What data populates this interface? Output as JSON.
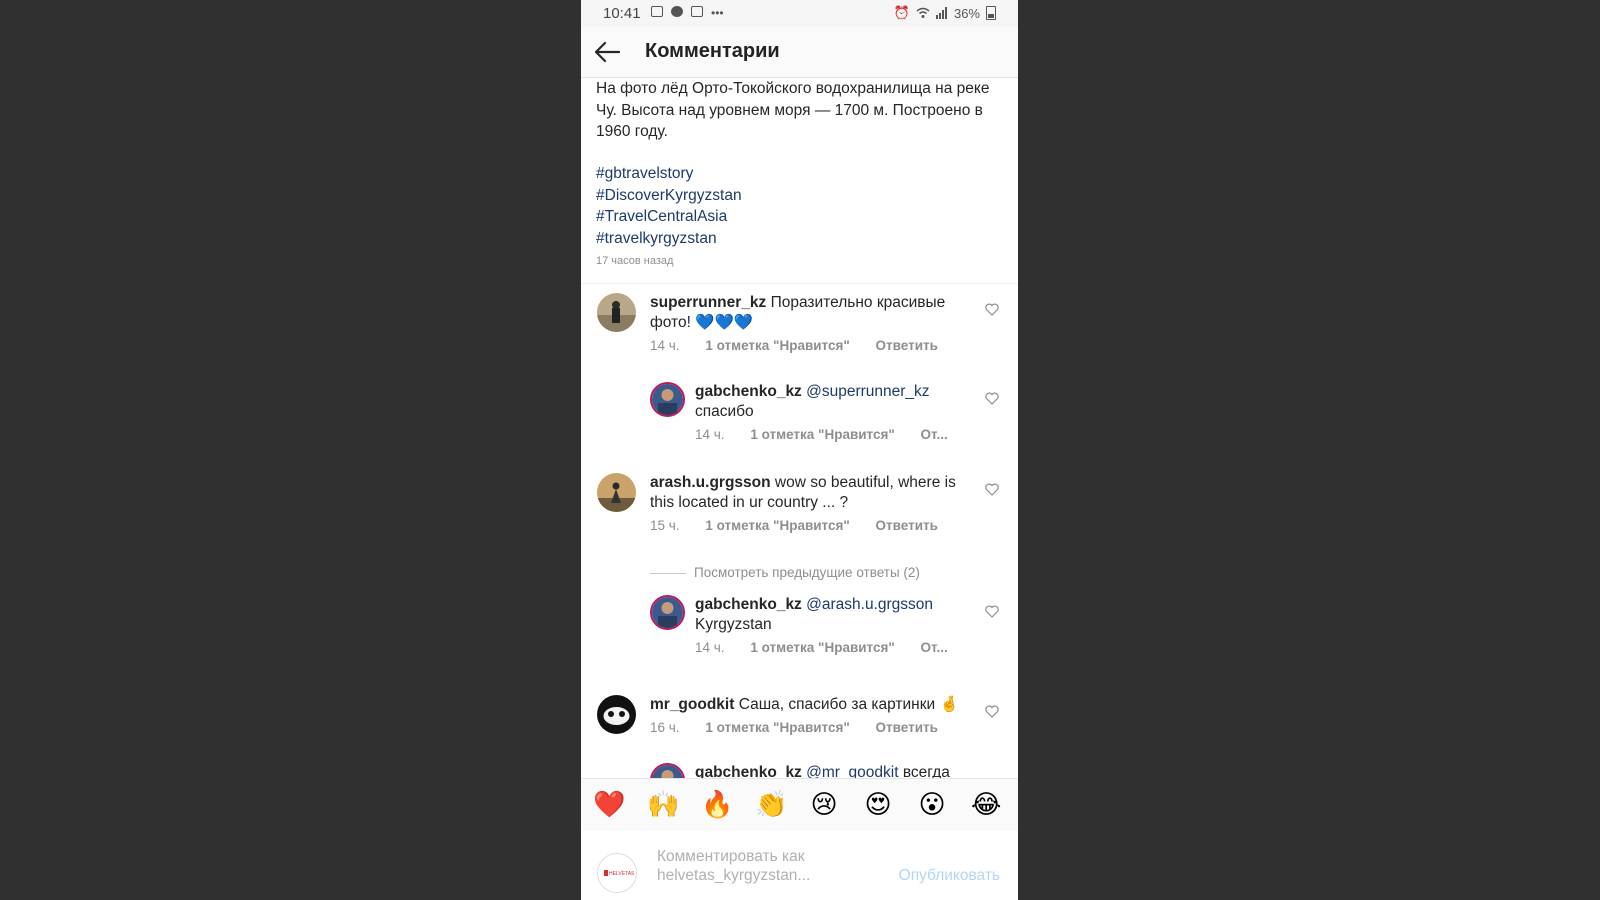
{
  "status_bar": {
    "time": "10:41",
    "battery": "36%",
    "left_icons": [
      "gallery-icon",
      "facebook-icon",
      "weather-icon",
      "more-dots-icon"
    ],
    "right_icons": [
      "alarm-icon",
      "wifi-icon",
      "signal-icon",
      "battery-icon"
    ]
  },
  "header": {
    "title": "Комментарии"
  },
  "post": {
    "caption": "На фото лёд Орто-Токойского водохранилища на реке Чу. Высота над уровнем моря — 1700 м. Построено в 1960 году.",
    "hashtags": [
      "#gbtravelstory",
      "#DiscoverKyrgyzstan",
      "#TravelCentralAsia",
      "#travelkyrgyzstan"
    ],
    "time": "17 часов назад"
  },
  "comments": [
    {
      "username": "superrunner_kz",
      "text": "Поразительно красивые фото! 💙💙💙",
      "time": "14 ч.",
      "likes": "1 отметка \"Нравится\"",
      "reply": "Ответить"
    },
    {
      "username": "gabchenko_kz",
      "mention": "@superrunner_kz",
      "text": "спасибо",
      "time": "14 ч.",
      "likes": "1 отметка \"Нравится\"",
      "reply": "От..."
    },
    {
      "username": "arash.u.grgsson",
      "text": "wow so beautiful, where is this located in ur country ... ?",
      "time": "15 ч.",
      "likes": "1 отметка \"Нравится\"",
      "reply": "Ответить"
    },
    {
      "username": "gabchenko_kz",
      "mention": "@arash.u.grgsson",
      "text": "Kyrgyzstan",
      "time": "14 ч.",
      "likes": "1 отметка \"Нравится\"",
      "reply": "От..."
    },
    {
      "username": "mr_goodkit",
      "text": "Саша, спасибо за картинки 🤞",
      "time": "16 ч.",
      "likes": "1 отметка \"Нравится\"",
      "reply": "Ответить"
    },
    {
      "username": "gabchenko_kz",
      "mention": "@mr_goodkit",
      "text": "всегда"
    }
  ],
  "view_previous": "Посмотреть предыдущие ответы (2)",
  "emojis": [
    "❤️",
    "🙌",
    "🔥",
    "👏",
    "😢",
    "😍",
    "😮",
    "😂"
  ],
  "input": {
    "placeholder": "Комментировать как helvetas_kyrgyzstan...",
    "publish": "Опубликовать",
    "avatar_text": "HELVETAS"
  }
}
